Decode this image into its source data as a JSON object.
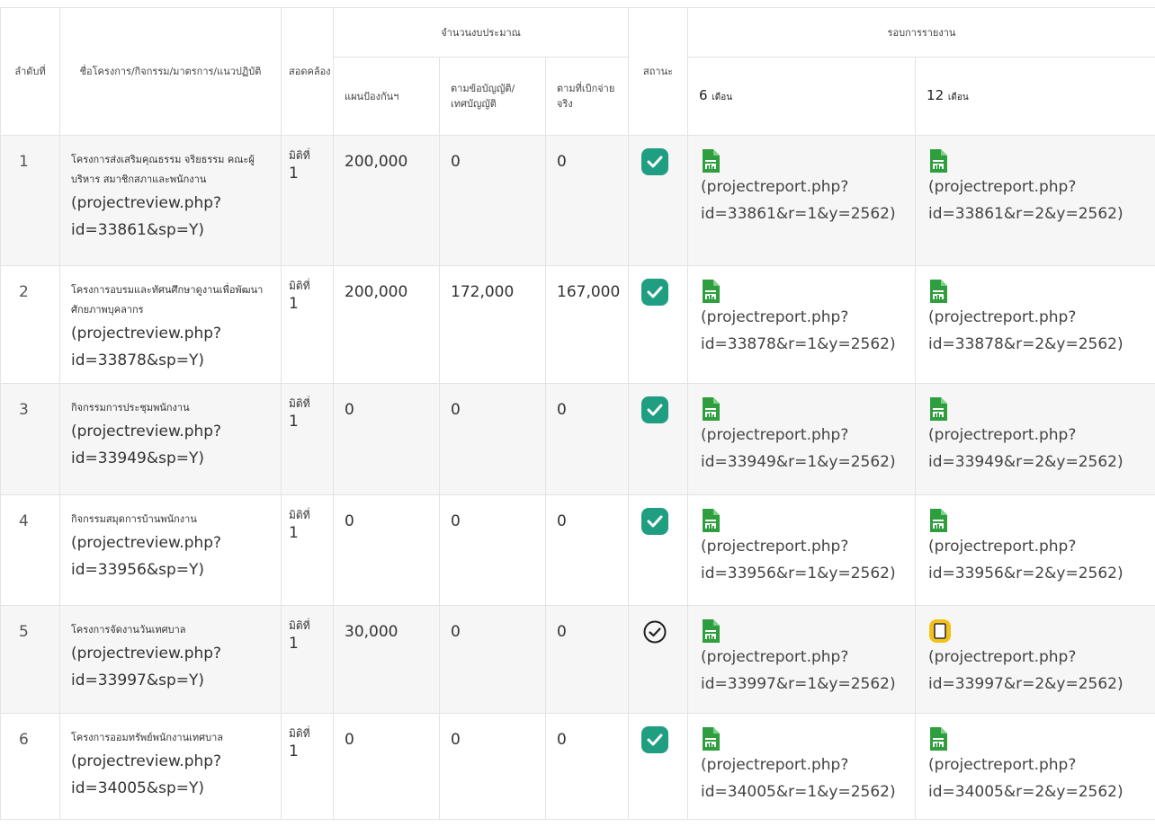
{
  "headers": {
    "index": "ลำดับที่",
    "project": "ชื่อโครงการ/กิจกรรม/มาตรการ/แนวปฏิบัติ",
    "conformity": "สอดคล้อง",
    "budget_group": "จำนวนงบประมาณ",
    "budget_plan": "แผนป้องกันฯ",
    "budget_regulation": "ตามข้อบัญญัติ/เทศบัญญัติ",
    "budget_actual": "ตามที่เบิกจ่ายจริง",
    "status": "สถานะ",
    "report_group": "รอบการรายงาน",
    "period_6": "6",
    "period_6_unit": "เดือน",
    "period_12": "12",
    "period_12_unit": "เดือน"
  },
  "rows": [
    {
      "index": "1",
      "title": "โครงการส่งเสริมคุณธรรม จริยธรรม คณะผู้บริหาร สมาชิกสภาและพนักงาน",
      "review_link": "(projectreview.php?id=33861&sp=Y)",
      "conformity_label": "มิติที่",
      "conformity_value": "1",
      "budget_plan": "200,000",
      "budget_regulation": "0",
      "budget_actual": "0",
      "status": "complete",
      "report_6_icon": "document-chart-icon",
      "report_6_link": "(projectreport.php?id=33861&r=1&y=2562)",
      "report_12_icon": "document-chart-icon",
      "report_12_link": "(projectreport.php?id=33861&r=2&y=2562)"
    },
    {
      "index": "2",
      "title": "โครงการอบรมและทัศนศึกษาดูงานเพื่อพัฒนาศักยภาพบุคลากร",
      "review_link": "(projectreview.php?id=33878&sp=Y)",
      "conformity_label": "มิติที่",
      "conformity_value": "1",
      "budget_plan": "200,000",
      "budget_regulation": "172,000",
      "budget_actual": "167,000",
      "status": "complete",
      "report_6_icon": "document-chart-icon",
      "report_6_link": "(projectreport.php?id=33878&r=1&y=2562)",
      "report_12_icon": "document-chart-icon",
      "report_12_link": "(projectreport.php?id=33878&r=2&y=2562)"
    },
    {
      "index": "3",
      "title": "กิจกรรมการประชุมพนักงาน",
      "review_link": "(projectreview.php?id=33949&sp=Y)",
      "conformity_label": "มิติที่",
      "conformity_value": "1",
      "budget_plan": "0",
      "budget_regulation": "0",
      "budget_actual": "0",
      "status": "complete",
      "report_6_icon": "document-chart-icon",
      "report_6_link": "(projectreport.php?id=33949&r=1&y=2562)",
      "report_12_icon": "document-chart-icon",
      "report_12_link": "(projectreport.php?id=33949&r=2&y=2562)"
    },
    {
      "index": "4",
      "title": "กิจกรรมสมุดการบ้านพนักงาน",
      "review_link": "(projectreview.php?id=33956&sp=Y)",
      "conformity_label": "มิติที่",
      "conformity_value": "1",
      "budget_plan": "0",
      "budget_regulation": "0",
      "budget_actual": "0",
      "status": "complete",
      "report_6_icon": "document-chart-icon",
      "report_6_link": "(projectreport.php?id=33956&r=1&y=2562)",
      "report_12_icon": "document-chart-icon",
      "report_12_link": "(projectreport.php?id=33956&r=2&y=2562)"
    },
    {
      "index": "5",
      "title": "โครงการจัดงานวันเทศบาล",
      "review_link": "(projectreview.php?id=33997&sp=Y)",
      "conformity_label": "มิติที่",
      "conformity_value": "1",
      "budget_plan": "30,000",
      "budget_regulation": "0",
      "budget_actual": "0",
      "status": "pending",
      "report_6_icon": "document-chart-icon",
      "report_6_link": "(projectreport.php?id=33997&r=1&y=2562)",
      "report_12_icon": "pending-document-icon",
      "report_12_link": "(projectreport.php?id=33997&r=2&y=2562)"
    },
    {
      "index": "6",
      "title": "โครงการออมทรัพย์พนักงานเทศบาล",
      "review_link": "(projectreview.php?id=34005&sp=Y)",
      "conformity_label": "มิติที่",
      "conformity_value": "1",
      "budget_plan": "0",
      "budget_regulation": "0",
      "budget_actual": "0",
      "status": "complete",
      "report_6_icon": "document-chart-icon",
      "report_6_link": "(projectreport.php?id=34005&r=1&y=2562)",
      "report_12_icon": "document-chart-icon",
      "report_12_link": "(projectreport.php?id=34005&r=2&y=2562)"
    }
  ],
  "colors": {
    "check_fill": "#1f9e82",
    "doc_icon": "#2e9e3e",
    "pending_icon_bg": "#f2c21b"
  }
}
